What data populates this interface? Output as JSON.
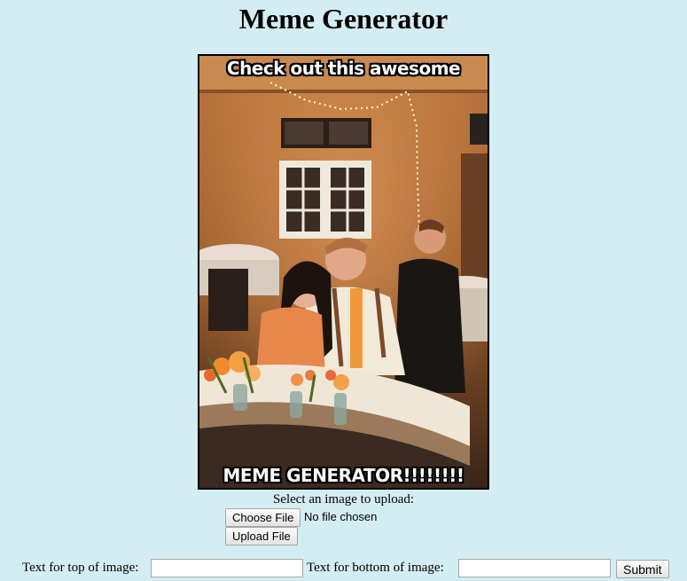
{
  "page": {
    "title": "Meme Generator"
  },
  "meme": {
    "top_text": "Check out this awesome",
    "bottom_text": "MEME GENERATOR!!!!!!!!"
  },
  "upload": {
    "label": "Select an image to upload:",
    "choose_file_label": "Choose File",
    "file_status": "No file chosen",
    "upload_button_label": "Upload File"
  },
  "form": {
    "top_text_label": "Text for top of image:",
    "top_text_value": "",
    "bottom_text_label": "Text for bottom of image:",
    "bottom_text_value": "",
    "submit_label": "Submit"
  },
  "colors": {
    "background": "#d4edf2"
  }
}
